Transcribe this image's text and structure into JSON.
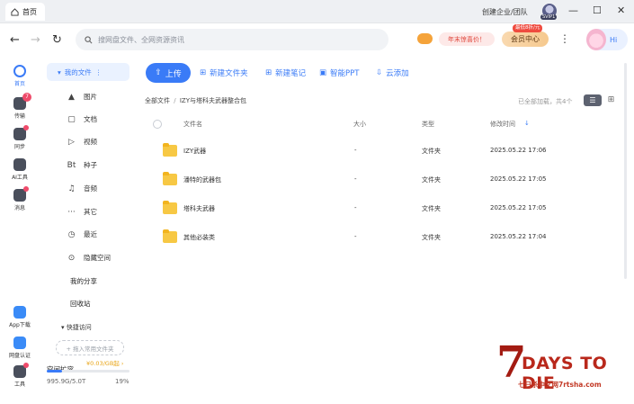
{
  "titlebar": {
    "tab_label": "首页",
    "corp_label": "创建企业/团队",
    "svip_label": "SVIP1",
    "controls": {
      "minimize": "—",
      "maximize": "☐",
      "close": "✕"
    }
  },
  "navbar": {
    "back": "←",
    "forward": "→",
    "refresh": "↻",
    "search_placeholder": "搜网盘文件、全网资源资讯",
    "promo_label": "年末惊喜价！",
    "vip_center_label": "会员中心",
    "vip_tag": "最低8折/元",
    "more": "⋮",
    "hi_label": "Hi"
  },
  "rail": [
    {
      "label": "首页",
      "active": true
    },
    {
      "label": "传输",
      "badge": "7"
    },
    {
      "label": "同步",
      "dot": true
    },
    {
      "label": "AI工具"
    },
    {
      "label": "消息",
      "dot": true
    },
    {
      "label": "App下载"
    },
    {
      "label": "网盘认证"
    },
    {
      "label": "工具",
      "dot": true
    }
  ],
  "sidebar": {
    "my_files": "我的文件",
    "items": [
      {
        "icon": "▲",
        "label": "图片"
      },
      {
        "icon": "▢",
        "label": "文档"
      },
      {
        "icon": "▷",
        "label": "视频"
      },
      {
        "icon": "Bt",
        "label": "种子"
      },
      {
        "icon": "♫",
        "label": "音频"
      },
      {
        "icon": "···",
        "label": "其它"
      },
      {
        "icon": "◷",
        "label": "最近"
      },
      {
        "icon": "⊙",
        "label": "隐藏空间"
      }
    ],
    "my_share": "我的分享",
    "recycle": "回收站",
    "quick_access": "快捷访问",
    "add_common": "+ 拖入常用文件夹",
    "storage_title": "空间扩容",
    "storage_price": "¥0.03/GB起 ›",
    "storage_used": "995.9G/5.0T",
    "storage_pct": "19%",
    "storage_fraction": 0.19
  },
  "toolbar": {
    "upload": "上传",
    "new_folder": "新建文件夹",
    "new_note": "新建笔记",
    "smart_ppt": "智能PPT",
    "cloud_add": "云添加"
  },
  "breadcrumb": {
    "root": "全部文件",
    "sep": "/",
    "current": "IZY与塔科夫武器整合包"
  },
  "loaded_text": "已全部加载，共4个",
  "table": {
    "headers": {
      "name": "文件名",
      "size": "大小",
      "type": "类型",
      "mtime": "修改时间"
    },
    "rows": [
      {
        "name": "IZY武器",
        "size": "-",
        "type": "文件夹",
        "mtime": "2025.05.22 17:06"
      },
      {
        "name": "潘特的武器包",
        "size": "-",
        "type": "文件夹",
        "mtime": "2025.05.22 17:05"
      },
      {
        "name": "塔科夫武器",
        "size": "-",
        "type": "文件夹",
        "mtime": "2025.05.22 17:05"
      },
      {
        "name": "其他必装类",
        "size": "-",
        "type": "文件夹",
        "mtime": "2025.05.22 17:04"
      }
    ]
  },
  "watermark": {
    "seven": "7",
    "title": "DAYS TO DIE",
    "sub": "七日杀中文网7rtsha.com"
  },
  "colors": {
    "accent": "#3a7bf7",
    "folder": "#f7c844",
    "watermark": "#b9281b"
  }
}
